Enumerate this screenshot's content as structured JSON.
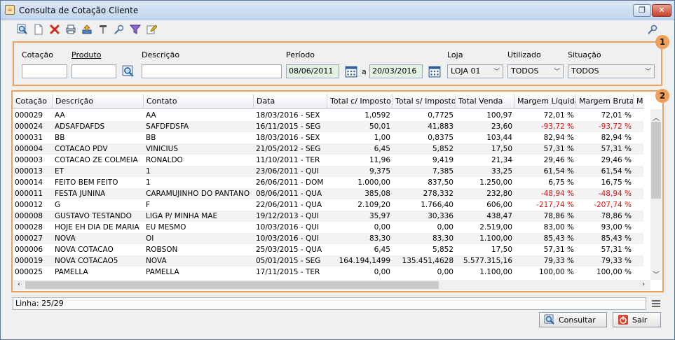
{
  "window": {
    "title": "Consulta de Cotação Cliente",
    "restore_glyph": "❐",
    "close_glyph": "✕"
  },
  "toolbar": {
    "icons": [
      "search-icon",
      "new-document-icon",
      "delete-icon",
      "print-icon",
      "export-icon",
      "tools-icon",
      "key-icon",
      "filter-icon",
      "edit-icon",
      "key-icon"
    ]
  },
  "badges": {
    "filter": "1",
    "results": "2"
  },
  "filters": {
    "cotacao_label": "Cotação",
    "produto_label": "Produto",
    "descricao_label": "Descrição",
    "periodo_label": "Período",
    "date_sep": "a",
    "date_from": "08/06/2011",
    "date_to": "20/03/2016",
    "loja_label": "Loja",
    "loja_value": "LOJA 01",
    "utilizado_label": "Utilizado",
    "utilizado_value": "TODOS",
    "situacao_label": "Situação",
    "situacao_value": "TODOS"
  },
  "table": {
    "columns": [
      "Cotação",
      "Descrição",
      "Contato",
      "Data",
      "Total c/ Imposto",
      "Total s/ Imposto",
      "Total Venda",
      "Margem Líquida",
      "Margem Bruta",
      "Mar"
    ],
    "rows": [
      [
        "000029",
        "AA",
        "AA",
        "18/03/2016 - SEX",
        "1,0592",
        "0,7725",
        "100,97",
        "72,01 %",
        "72,01 %"
      ],
      [
        "000024",
        "ADSAFDAFDS",
        "SAFDFDSFA",
        "16/11/2015 - SEG",
        "50,01",
        "41,883",
        "23,60",
        "-93,72 %",
        "-93,72 %"
      ],
      [
        "000031",
        "BB",
        "BB",
        "18/03/2016 - SEX",
        "1,00",
        "0,8375",
        "103,44",
        "82,94 %",
        "82,94 %"
      ],
      [
        "000004",
        "COTACAO PDV",
        "VINICIUS",
        "21/05/2012 - SEG",
        "6,45",
        "5,852",
        "17,50",
        "57,31 %",
        "57,31 %"
      ],
      [
        "000003",
        "COTACAO ZE COLMEIA",
        "RONALDO",
        "11/10/2011 - TER",
        "11,96",
        "9,419",
        "21,34",
        "29,46 %",
        "29,46 %"
      ],
      [
        "000013",
        "ET",
        "1",
        "23/06/2011 - QUI",
        "9,375",
        "7,385",
        "33,25",
        "61,54 %",
        "61,54 %"
      ],
      [
        "000014",
        "FEITO BEM FEITO",
        "1",
        "26/06/2011 - DOM",
        "1.000,00",
        "837,50",
        "1.250,00",
        "6,75 %",
        "16,75 %"
      ],
      [
        "000011",
        "FESTA JUNINA",
        "CARAMUJINHO DO PANTANO",
        "08/06/2011 - QUA",
        "385,08",
        "278,332",
        "232,80",
        "-48,94 %",
        "-48,94 %"
      ],
      [
        "000012",
        "G",
        "F",
        "22/06/2011 - QUA",
        "2.109,20",
        "1.766,40",
        "606,00",
        "-217,74 %",
        "-207,74 %"
      ],
      [
        "000008",
        "GUSTAVO TESTANDO",
        "LIGA P/ MINHA MAE",
        "19/12/2013 - QUI",
        "35,97",
        "30,336",
        "438,47",
        "78,86 %",
        "78,86 %"
      ],
      [
        "000028",
        "HOJE EH DIA DE MARIA",
        "EU MESMO",
        "10/03/2016 - QUI",
        "0,00",
        "0,00",
        "2.519,00",
        "83,00 %",
        "93,00 %"
      ],
      [
        "000027",
        "NOVA",
        "OI",
        "10/03/2016 - QUI",
        "83,30",
        "83,30",
        "1.100,00",
        "85,43 %",
        "85,43 %"
      ],
      [
        "000006",
        "NOVA COTACAO",
        "ROBSON",
        "25/03/2015 - QUA",
        "6,45",
        "5,852",
        "17,50",
        "57,31 %",
        "57,31 %"
      ],
      [
        "000019",
        "NOVA COTACAO5",
        "NOVA",
        "05/01/2015 - SEG",
        "164.194,1499",
        "135.451,4628",
        "5.577.315,16",
        "79,33 %",
        "79,33 %"
      ],
      [
        "000025",
        "PAMELLA",
        "PAMELLA",
        "17/11/2015 - TER",
        "0,00",
        "0,00",
        "1.100,00",
        "100,00 %",
        "100,00 %"
      ]
    ]
  },
  "status": {
    "line": "Linha: 25/29"
  },
  "buttons": {
    "consultar": "Consultar",
    "sair": "Sair"
  },
  "colors": {
    "accent": "#f0a05a",
    "negative": "#e01010"
  }
}
